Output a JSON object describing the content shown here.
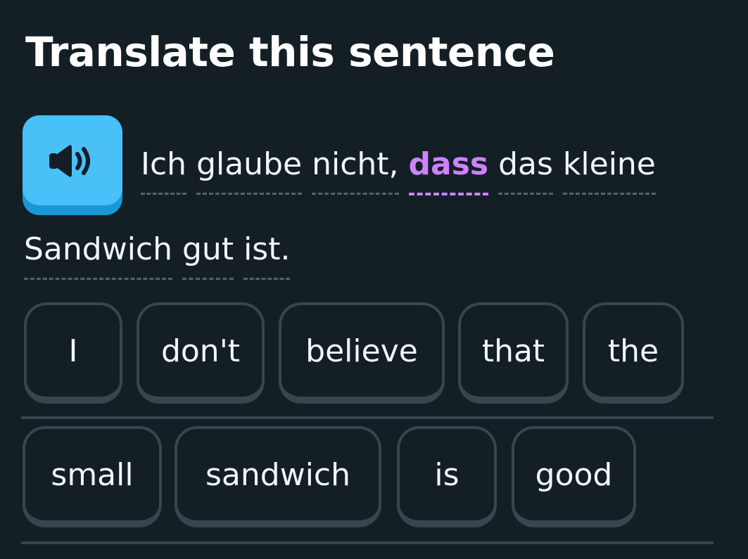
{
  "header": {
    "title": "Translate this sentence"
  },
  "prompt": {
    "speaker_icon": "speaker-icon",
    "line1": [
      {
        "text": "Ich",
        "highlight": false
      },
      {
        "text": "glaube",
        "highlight": false
      },
      {
        "text": "nicht,",
        "highlight": false
      },
      {
        "text": "dass",
        "highlight": true
      },
      {
        "text": "das",
        "highlight": false
      },
      {
        "text": "kleine",
        "highlight": false
      }
    ],
    "line2": [
      {
        "text": "Sandwich",
        "highlight": false
      },
      {
        "text": "gut",
        "highlight": false
      },
      {
        "text": "ist.",
        "highlight": false
      }
    ]
  },
  "word_bank": {
    "row1": [
      "I",
      "don't",
      "believe",
      "that",
      "the"
    ],
    "row2": [
      "small",
      "sandwich",
      "is",
      "good"
    ]
  },
  "colors": {
    "background": "#131f24",
    "speaker_button": "#49c0f8",
    "highlight": "#ce82ff",
    "tile_border": "#37464f",
    "text": "#f1f7fb"
  }
}
